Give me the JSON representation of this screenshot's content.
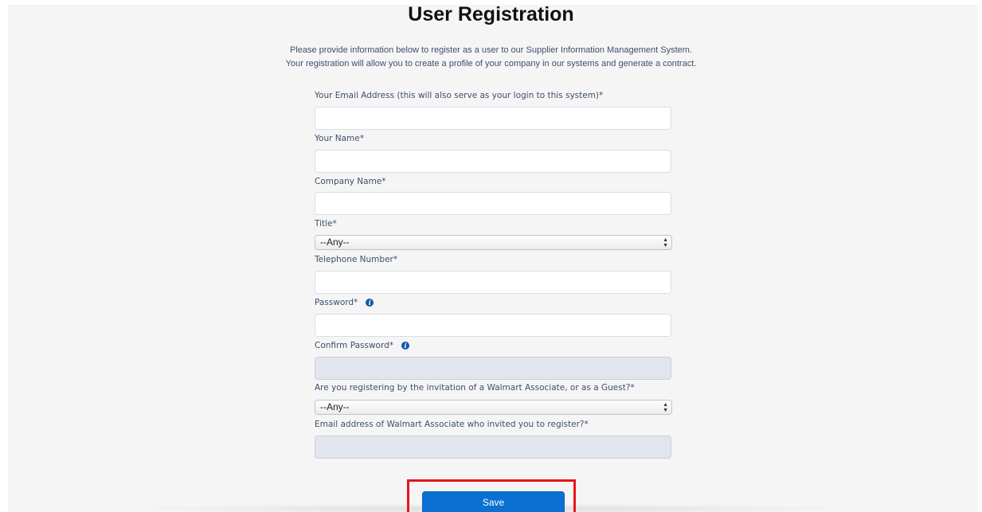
{
  "page": {
    "title": "User Registration",
    "intro_line1": "Please provide information below to register as a user to our Supplier Information Management System.",
    "intro_line2": "Your registration will allow you to create a profile of your company in our systems and generate a contract."
  },
  "form": {
    "email": {
      "label": "Your Email Address (this will also serve as your login to this system)*",
      "value": ""
    },
    "name": {
      "label": "Your Name*",
      "value": ""
    },
    "company": {
      "label": "Company Name*",
      "value": ""
    },
    "title": {
      "label": "Title*",
      "selected": "--Any--"
    },
    "telephone": {
      "label": "Telephone Number*",
      "value": ""
    },
    "password": {
      "label": "Password*",
      "value": ""
    },
    "confirm_password": {
      "label": "Confirm Password*",
      "value": ""
    },
    "invitation": {
      "label": "Are you registering by the invitation of a Walmart Associate, or as a Guest?*",
      "selected": "--Any--"
    },
    "associate_email": {
      "label": "Email address of Walmart Associate who invited you to register?*",
      "value": ""
    }
  },
  "actions": {
    "save_label": "Save"
  },
  "icons": {
    "info": "info-icon",
    "select_arrows": "up-down-arrows-icon"
  },
  "colors": {
    "save_button": "#0a70d2",
    "highlight": "#e8141c",
    "label_text": "#3e4e6c",
    "info_icon": "#0b5cab"
  }
}
